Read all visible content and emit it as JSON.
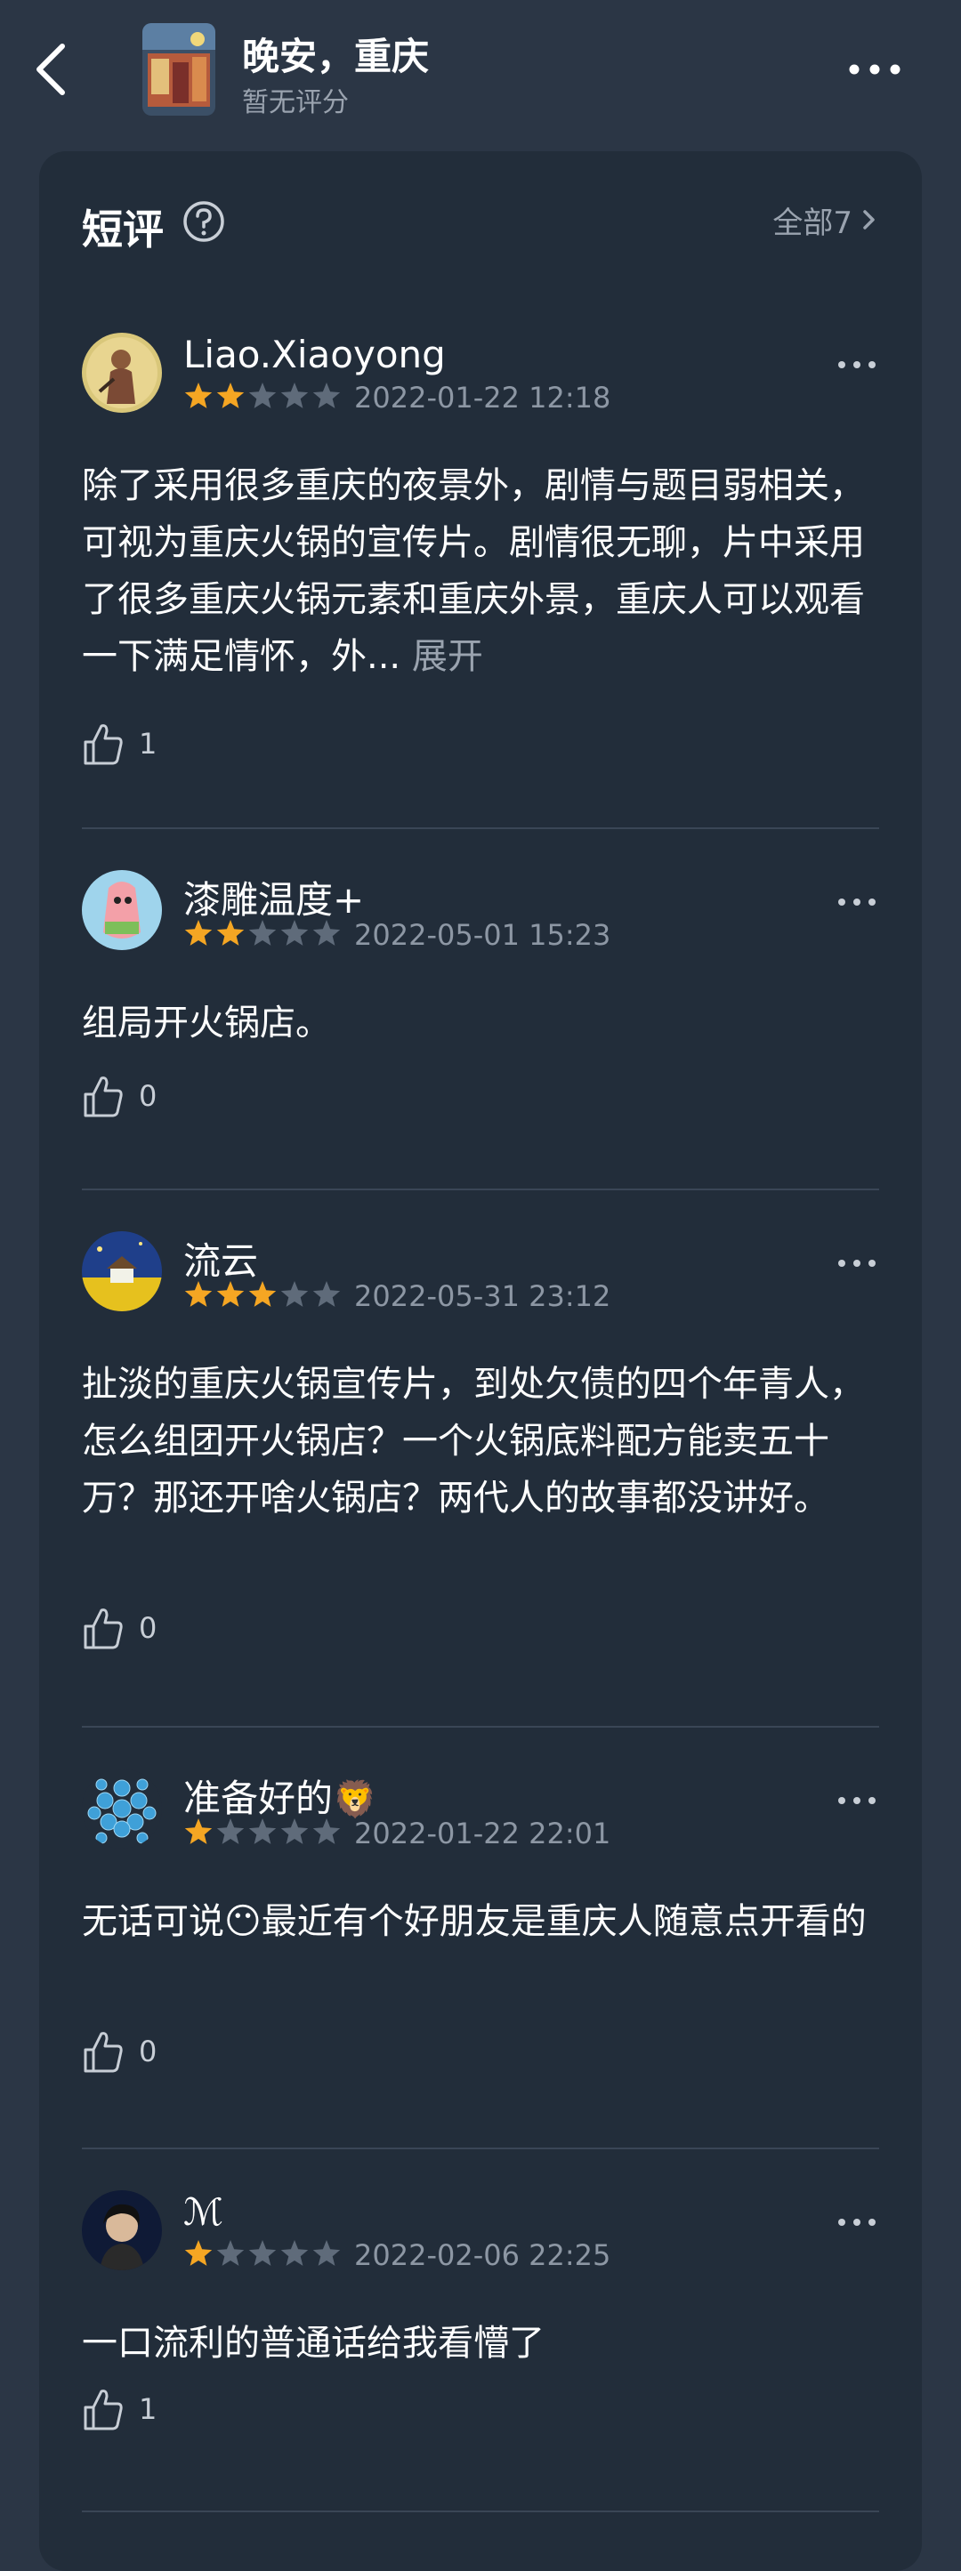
{
  "header": {
    "title": "晚安，重庆",
    "subtitle": "暂无评分"
  },
  "section": {
    "title": "短评",
    "all_label": "全部7"
  },
  "reviews": [
    {
      "user": "Liao.Xiaoyong",
      "rating": 2,
      "date": "2022-01-22 12:18",
      "text": "除了采用很多重庆的夜景外，剧情与题目弱相关，可视为重庆火锅的宣传片。剧情很无聊，片中采用了很多重庆火锅元素和重庆外景，重庆人可以观看一下满足情怀，外...",
      "expand": "展开",
      "likes": "1"
    },
    {
      "user": "漆雕温度+",
      "rating": 2,
      "date": "2022-05-01 15:23",
      "text": "组局开火锅店。",
      "likes": "0"
    },
    {
      "user": "流云",
      "rating": 3,
      "date": "2022-05-31 23:12",
      "text": "扯淡的重庆火锅宣传片，到处欠债的四个年青人，怎么组团开火锅店？一个火锅底料配方能卖五十万？那还开啥火锅店？两代人的故事都没讲好。",
      "likes": "0"
    },
    {
      "user": "准备好的",
      "user_emoji": "🦁",
      "rating": 1,
      "date": "2022-01-22 22:01",
      "text_before": "无话可说",
      "text_emoji": "😶",
      "text_after": "最近有个好朋友是重庆人随意点开看的",
      "likes": "0"
    },
    {
      "user": "ℳ",
      "rating": 1,
      "date": "2022-02-06 22:25",
      "text": "一口流利的普通话给我看懵了",
      "likes": "1"
    }
  ],
  "colors": {
    "page_bg": "#2b3645",
    "card_bg": "#222d3a",
    "star_on": "#f5a623",
    "star_off": "#5f6b7a",
    "muted_text": "#8d97a4"
  }
}
